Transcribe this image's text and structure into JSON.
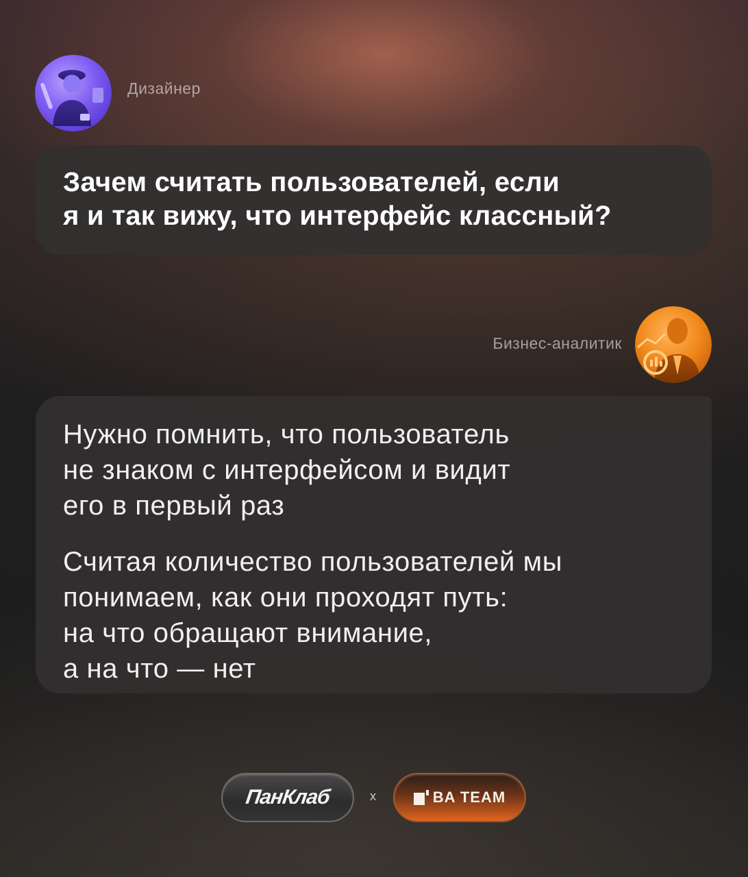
{
  "designer": {
    "role": "Дизайнер",
    "avatar_icon": "designer-avatar-icon",
    "question_lines": [
      "Зачем считать пользователей, если",
      "я и так вижу, что интерфейс классный?"
    ]
  },
  "analyst": {
    "role": "Бизнес-аналитик",
    "avatar_icon": "analyst-avatar-icon",
    "answer_paragraph_1_lines": [
      "Нужно помнить, что пользователь",
      "не знаком с интерфейсом и видит",
      "его в первый раз"
    ],
    "answer_paragraph_2_lines": [
      "Считая количество пользователей мы",
      "понимаем, как они проходят путь:",
      "на что обращают внимание,",
      "а на что — нет"
    ]
  },
  "footer": {
    "left_brand": "ПанКлаб",
    "separator": "x",
    "right_brand": "BA TEAM"
  },
  "colors": {
    "bubble_bg": "#323030",
    "designer_avatar": "#7b5cf0",
    "analyst_avatar": "#f28a1c",
    "ba_badge_accent": "#e2641f"
  }
}
